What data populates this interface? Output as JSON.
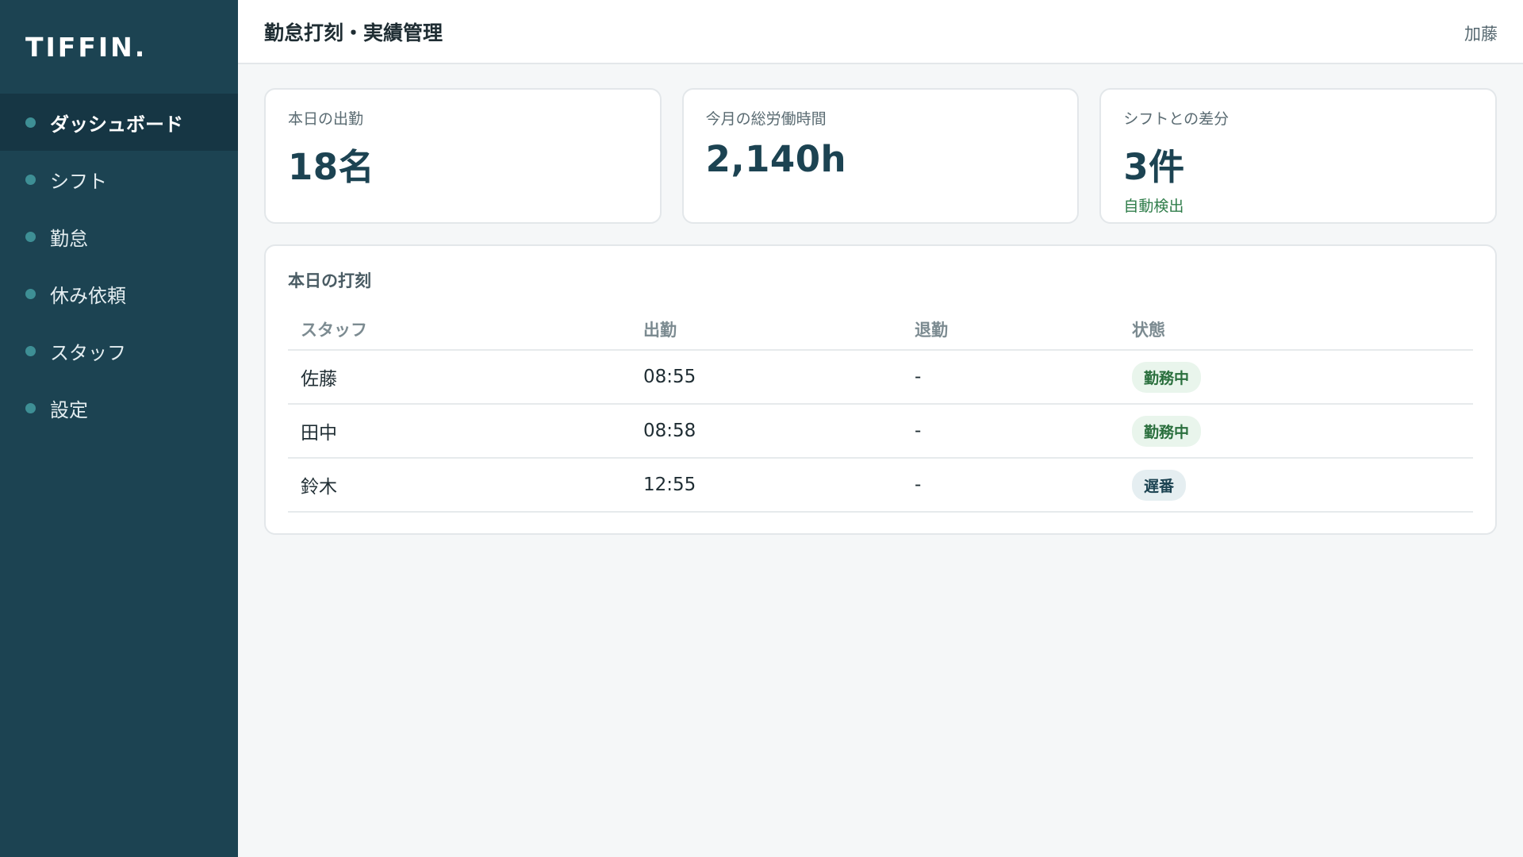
{
  "brand": {
    "logo_text": "TIFFIN."
  },
  "sidebar": {
    "items": [
      {
        "label": "ダッシュボード",
        "active": true
      },
      {
        "label": "シフト",
        "active": false
      },
      {
        "label": "勤怠",
        "active": false
      },
      {
        "label": "休み依頼",
        "active": false
      },
      {
        "label": "スタッフ",
        "active": false
      },
      {
        "label": "設定",
        "active": false
      }
    ]
  },
  "header": {
    "title": "勤怠打刻・実績管理",
    "user": "加藤"
  },
  "stats": [
    {
      "label": "本日の出勤",
      "value": "18名",
      "note": ""
    },
    {
      "label": "今月の総労働時間",
      "value": "2,140h",
      "note": ""
    },
    {
      "label": "シフトとの差分",
      "value": "3件",
      "note": "自動検出"
    }
  ],
  "punch_table": {
    "title": "本日の打刻",
    "columns": [
      "スタッフ",
      "出勤",
      "退勤",
      "状態"
    ],
    "rows": [
      {
        "staff": "佐藤",
        "clock_in": "08:55",
        "clock_out": "-",
        "status": "勤務中"
      },
      {
        "staff": "田中",
        "clock_in": "08:58",
        "clock_out": "-",
        "status": "勤務中"
      },
      {
        "staff": "鈴木",
        "clock_in": "12:55",
        "clock_out": "-",
        "status": "遅番"
      }
    ]
  },
  "colors": {
    "sidebar_bg": "#1c4352",
    "sidebar_active_bg": "#163644",
    "nav_dot": "#3e8f95",
    "accent_green": "#2f7d4a",
    "page_bg": "#f5f7f8"
  }
}
